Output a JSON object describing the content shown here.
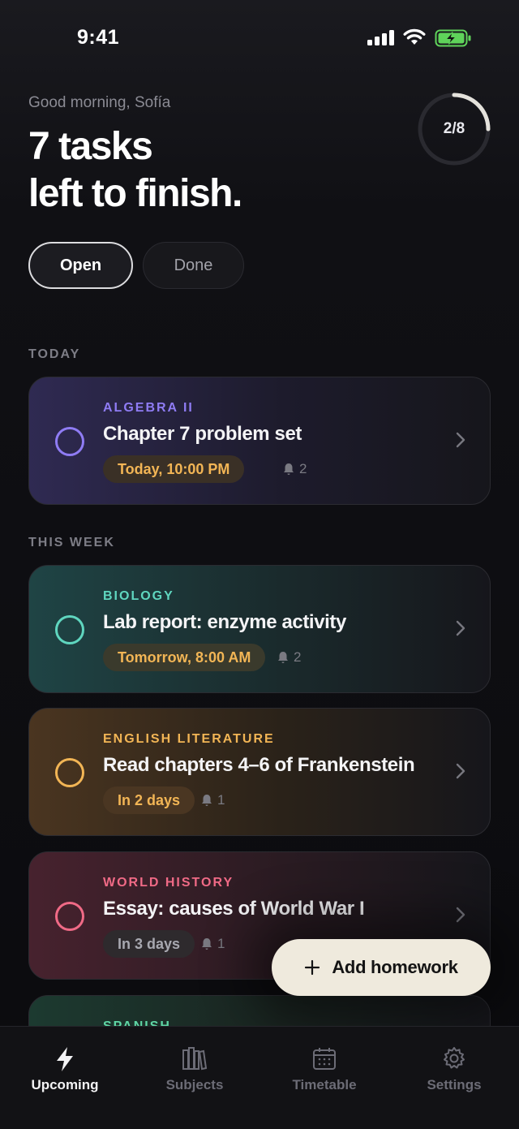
{
  "status_bar": {
    "time": "9:41"
  },
  "header": {
    "greeting": "Good morning, Sofía",
    "headline_line1": "7 tasks",
    "headline_line2": "left to finish.",
    "progress_label": "2/8",
    "progress_fraction": 0.25
  },
  "filter": {
    "open_label": "Open",
    "done_label": "Done",
    "selected": "Open"
  },
  "sections": {
    "today": "TODAY",
    "this_week": "THIS WEEK"
  },
  "tasks": [
    {
      "subject": "ALGEBRA II",
      "title": "Chapter 7 problem set",
      "due": "Today, 10:00 PM",
      "reminders": "2",
      "color": "#8f7cf4"
    },
    {
      "subject": "BIOLOGY",
      "title": "Lab report: enzyme activity",
      "due": "Tomorrow, 8:00 AM",
      "reminders": "2",
      "color": "#5fd6bf"
    },
    {
      "subject": "ENGLISH LITERATURE",
      "title": "Read chapters 4–6 of Frankenstein",
      "due": "In 2 days",
      "reminders": "1",
      "color": "#f2b555"
    },
    {
      "subject": "WORLD HISTORY",
      "title": "Essay: causes of World War I",
      "due": "In 3 days",
      "reminders": "1",
      "color": "#f06a86"
    },
    {
      "subject": "SPANISH",
      "color": "#5fd6a5"
    }
  ],
  "fab": {
    "label": "Add homework"
  },
  "tabbar": {
    "upcoming": "Upcoming",
    "subjects": "Subjects",
    "timetable": "Timetable",
    "settings": "Settings",
    "active": "Upcoming"
  }
}
